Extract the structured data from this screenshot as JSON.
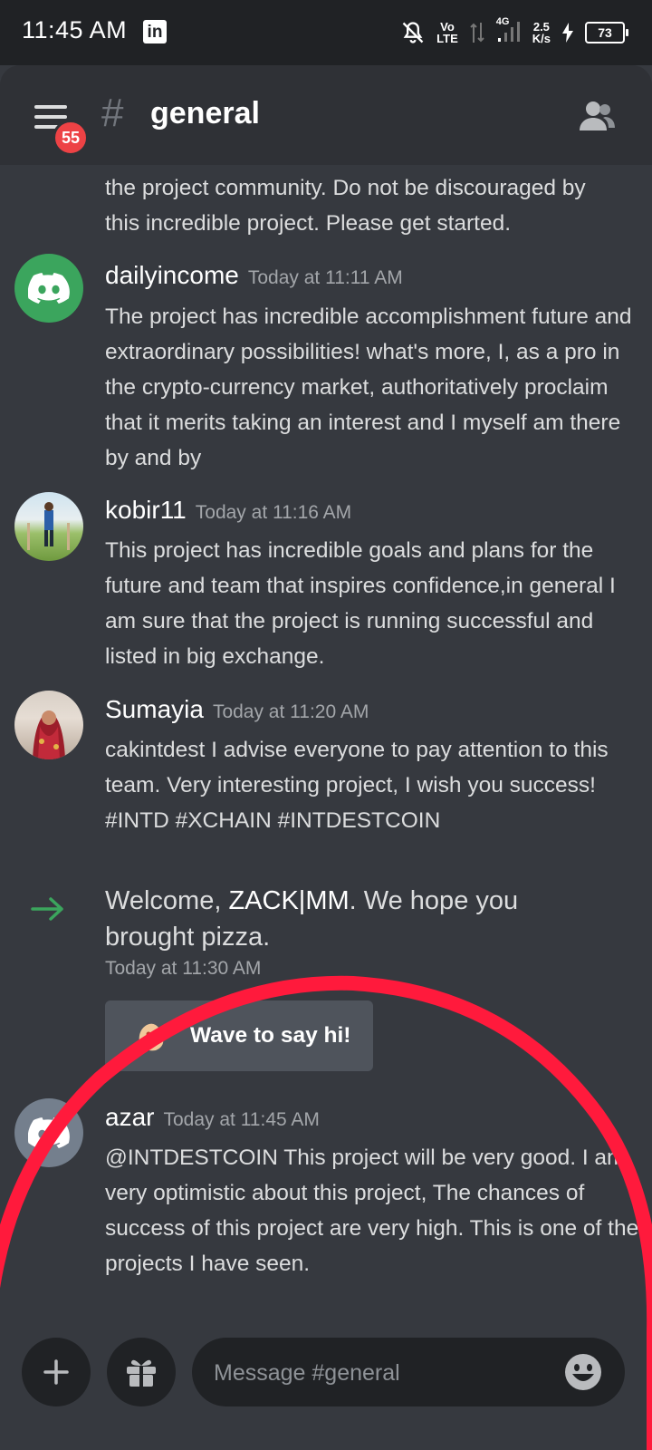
{
  "status_bar": {
    "time": "11:45 AM",
    "app_icon": "linkedin-icon",
    "volte_top": "Vo",
    "volte_bottom": "LTE",
    "network": "4G",
    "speed_top": "2.5",
    "speed_bottom": "K/s",
    "battery": "73"
  },
  "header": {
    "menu_badge": "55",
    "hash": "#",
    "channel_name": "general"
  },
  "messages": {
    "continued_line1": "the project community. Do not be discouraged by",
    "continued_line2": "this incredible project. Please get started.",
    "items": [
      {
        "username": "dailyincome",
        "timestamp": "Today at 11:11 AM",
        "text": "The project has incredible accomplishment future and extraordinary possibilities! what's more, I, as a pro in the crypto-currency market, authoritatively proclaim that it merits taking an interest and I myself am there by and by"
      },
      {
        "username": "kobir11",
        "timestamp": "Today at 11:16 AM",
        "text": "This project has incredible goals and plans for the future and  team that inspires confidence,in general I am sure that the project is running successful and listed in big exchange."
      },
      {
        "username": "Sumayia",
        "timestamp": "Today at 11:20 AM",
        "text": "cakintdest  I advise everyone to pay attention to this team. Very interesting project, I wish you success!",
        "tags": " #INTD #XCHAIN   #INTDESTCOIN"
      },
      {
        "username": "azar",
        "timestamp": "Today at 11:45 AM",
        "text": "@INTDESTCOIN This project will be very good. I am very optimistic about this project, The chances of success of this project are very high. This is one of the projects I have seen."
      }
    ],
    "welcome": {
      "prefix": "Welcome, ",
      "member": "ZACK|MM",
      "suffix": ". We hope you brought pizza.",
      "timestamp": "Today at 11:30 AM",
      "wave_label": "Wave to say hi!"
    }
  },
  "composer": {
    "placeholder": "Message #general"
  },
  "colors": {
    "background": "#36393f",
    "header": "#2f3136",
    "input": "#202225",
    "badge": "#ed4245",
    "discord_green": "#3ba55d",
    "welcome_arrow": "#3ba55d",
    "annotation_circle": "#ff1a3c"
  }
}
